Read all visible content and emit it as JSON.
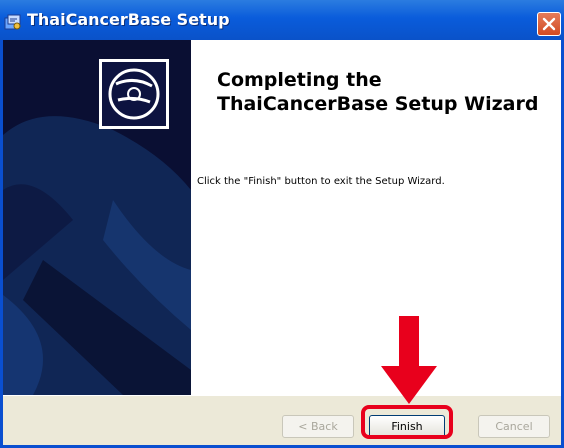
{
  "window": {
    "title": "ThaiCancerBase Setup"
  },
  "content": {
    "heading_line1": "Completing the",
    "heading_line2": "ThaiCancerBase Setup Wizard",
    "body": "Click the \"Finish\" button to exit the Setup Wizard."
  },
  "buttons": {
    "back": "< Back",
    "finish": "Finish",
    "cancel": "Cancel"
  },
  "colors": {
    "title_bar": "#0a5cdb",
    "banner": "#0a0f33",
    "button_bar": "#ece9d8",
    "annotation": "#e8001c"
  },
  "icons": {
    "app": "setup-app-icon",
    "close": "close-icon",
    "banner": "cd-disc-icon",
    "annotation": "red-arrow-annotation"
  }
}
